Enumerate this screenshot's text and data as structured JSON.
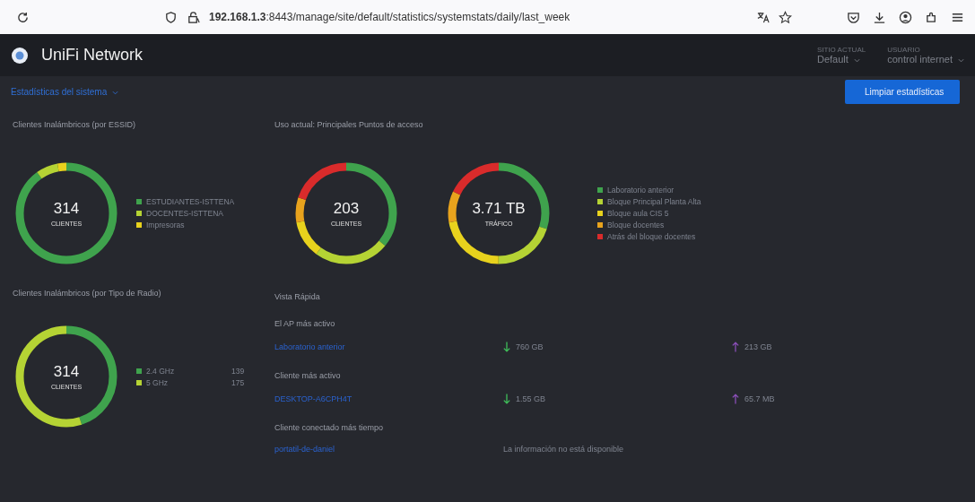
{
  "browser": {
    "url": "**192.168.1.3**:8443/manage/site/default/statistics/systemstats/daily/last_week"
  },
  "app": {
    "title": "UniFi Network",
    "site": {
      "label": "SITIO ACTUAL",
      "value": "Default"
    },
    "user": {
      "label": "USUARIO",
      "value": "control internet"
    }
  },
  "subbar": {
    "menu": "Estadísticas del sistema",
    "button": "Limpiar estadísticas"
  },
  "ssid_panel": {
    "title": "Clientes Inalámbricos (por ESSID)",
    "value": "314",
    "unit": "CLIENTES",
    "legend": [
      {
        "label": "ESTUDIANTES-ISTTENA",
        "color": "#3fa34d"
      },
      {
        "label": "DOCENTES-ISTTENA",
        "color": "#b5d334"
      },
      {
        "label": "Impresoras",
        "color": "#e8d21d"
      }
    ]
  },
  "ap_panel": {
    "title": "Uso actual: Principales Puntos de acceso",
    "donuts": [
      {
        "value": "203",
        "unit": "CLIENTES"
      },
      {
        "value": "3.71 TB",
        "unit": "TRÁFICO"
      }
    ],
    "legend": [
      {
        "label": "Laboratorio anterior",
        "color": "#3fa34d"
      },
      {
        "label": "Bloque Principal Planta Alta",
        "color": "#b5d334"
      },
      {
        "label": "Bloque aula CIS 5",
        "color": "#e8d21d"
      },
      {
        "label": "Bloque docentes",
        "color": "#e8a31d"
      },
      {
        "label": "Atrás del bloque docentes",
        "color": "#d92b2b"
      }
    ]
  },
  "radio_panel": {
    "title": "Clientes Inalámbricos (por Tipo de Radio)",
    "value": "314",
    "unit": "CLIENTES",
    "legend": [
      {
        "label": "2.4 GHz",
        "count": "139",
        "color": "#3fa34d"
      },
      {
        "label": "5 GHz",
        "count": "175",
        "color": "#b5d334"
      }
    ]
  },
  "quick_view": {
    "title": "Vista Rápida",
    "sections": [
      {
        "heading": "El AP más activo",
        "link": "Laboratorio anterior",
        "kind": "traffic",
        "down": "760 GB",
        "up": "213 GB"
      },
      {
        "heading": "Cliente más activo",
        "link": "DESKTOP-A6CPH4T",
        "kind": "traffic",
        "down": "1.55 GB",
        "up": "65.7 MB"
      },
      {
        "heading": "Cliente conectado más tiempo",
        "link": "portatil-de-daniel",
        "kind": "message",
        "message": "La información no está disponible"
      }
    ]
  }
}
